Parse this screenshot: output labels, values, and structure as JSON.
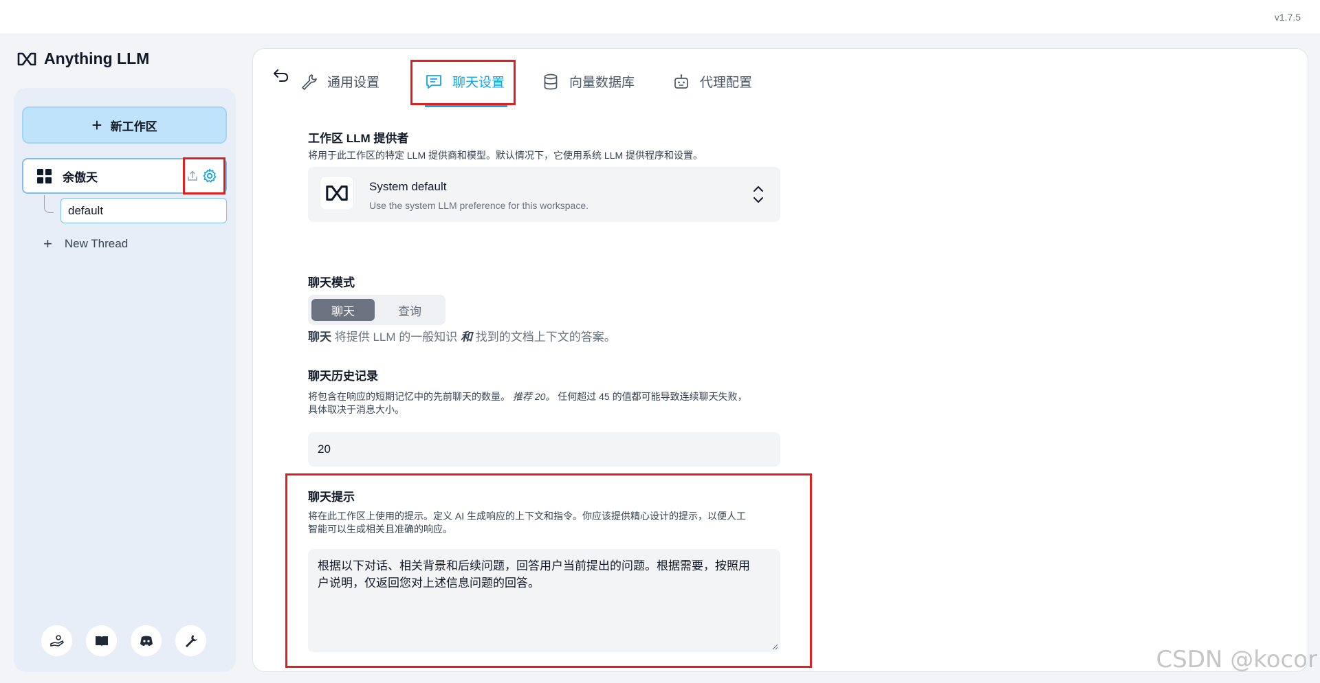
{
  "app": {
    "version": "v1.7.5",
    "brand": "Anything LLM"
  },
  "sidebar": {
    "new_workspace_label": "新工作区",
    "workspace": {
      "name": "余傲天"
    },
    "threads": [
      {
        "label": "default"
      }
    ],
    "new_thread_label": "New Thread",
    "footer_icons": [
      "community-hub-icon",
      "docs-book-icon",
      "discord-icon",
      "wrench-settings-icon"
    ]
  },
  "tabs": [
    {
      "label": "通用设置",
      "icon": "wrench-icon",
      "active": false
    },
    {
      "label": "聊天设置",
      "icon": "chat-icon",
      "active": true
    },
    {
      "label": "向量数据库",
      "icon": "database-icon",
      "active": false
    },
    {
      "label": "代理配置",
      "icon": "robot-icon",
      "active": false
    }
  ],
  "llm_provider": {
    "title": "工作区 LLM 提供者",
    "description": "将用于此工作区的特定 LLM 提供商和模型。默认情况下，它使用系统 LLM 提供程序和设置。",
    "selected_name": "System default",
    "selected_sub": "Use the system LLM preference for this workspace."
  },
  "chat_mode": {
    "title": "聊天模式",
    "options": [
      "聊天",
      "查询"
    ],
    "selected": "聊天",
    "desc_bold": "聊天",
    "desc_mid": " 将提供 LLM 的一般知识 ",
    "desc_italic": "和",
    "desc_end": " 找到的文档上下文的答案。"
  },
  "chat_history": {
    "title": "聊天历史记录",
    "desc_line1_a": "将包含在响应的短期记忆中的先前聊天的数量。",
    "desc_line1_italic": "推荐 20。",
    "desc_line1_b": " 任何超过 45 的值都可能导致连续聊天失败，",
    "desc_line2": "具体取决于消息大小。",
    "value": "20"
  },
  "chat_prompt": {
    "title": "聊天提示",
    "desc_line1": "将在此工作区上使用的提示。定义 AI 生成响应的上下文和指令。你应该提供精心设计的提示，以便人工",
    "desc_line2": "智能可以生成相关且准确的响应。",
    "value_line1": "根据以下对话、相关背景和后续问题，回答用户当前提出的问题。根据需要，按照用",
    "value_line2": "户说明，仅返回您对上述信息问题的回答。"
  },
  "watermark": "CSDN @kocor"
}
